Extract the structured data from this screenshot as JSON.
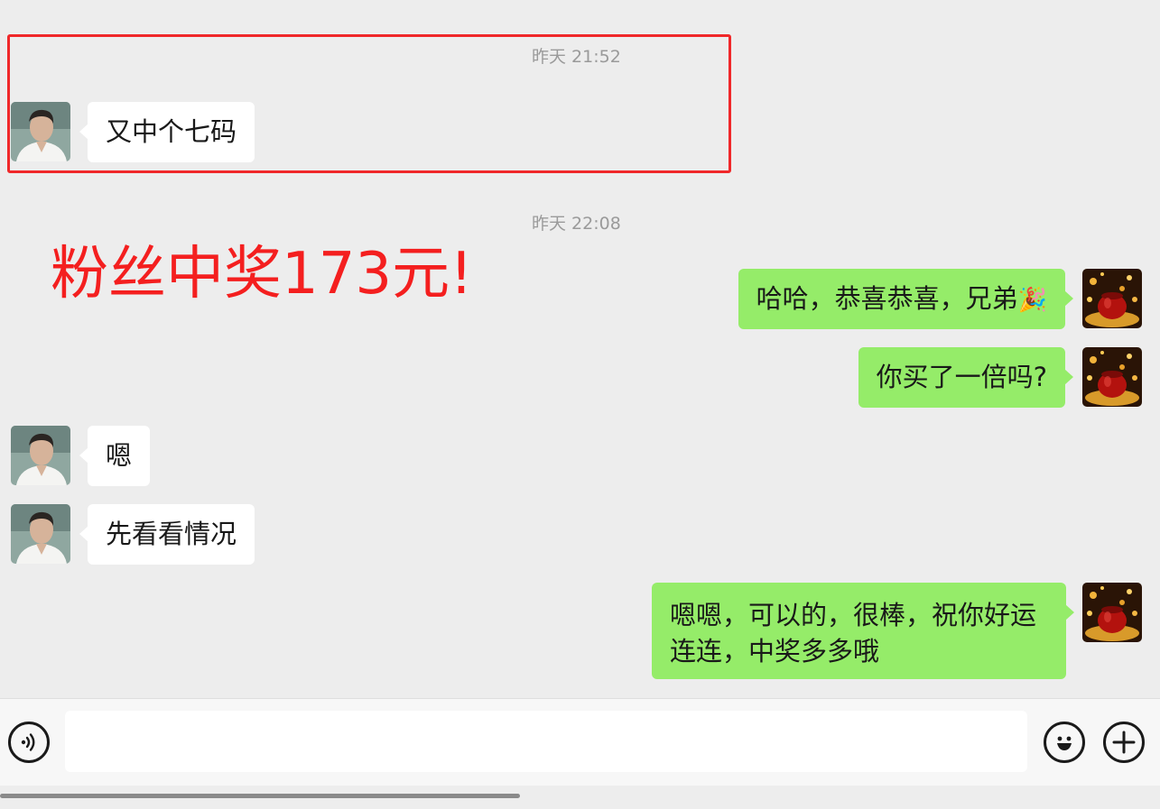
{
  "chat": {
    "timestamps": [
      "昨天 21:52",
      "昨天 22:08"
    ],
    "headline": "粉丝中奖173元!",
    "messages": [
      {
        "side": "in",
        "text": "又中个七码"
      },
      {
        "side": "out",
        "text": "哈哈，恭喜恭喜，兄弟",
        "emoji": "🎉"
      },
      {
        "side": "out",
        "text": "你买了一倍吗?"
      },
      {
        "side": "in",
        "text": "嗯"
      },
      {
        "side": "in",
        "text": "先看看情况"
      },
      {
        "side": "out",
        "text": "嗯嗯，可以的，很棒，祝你好运连连，中奖多多哦"
      }
    ]
  },
  "input_bar": {
    "placeholder": "",
    "icons": [
      "voice-icon",
      "emoji-icon",
      "plus-icon"
    ]
  },
  "colors": {
    "background": "#ededed",
    "incoming_bubble": "#ffffff",
    "outgoing_bubble": "#95ec69",
    "highlight": "#f0282a",
    "headline": "#f41f1f"
  }
}
